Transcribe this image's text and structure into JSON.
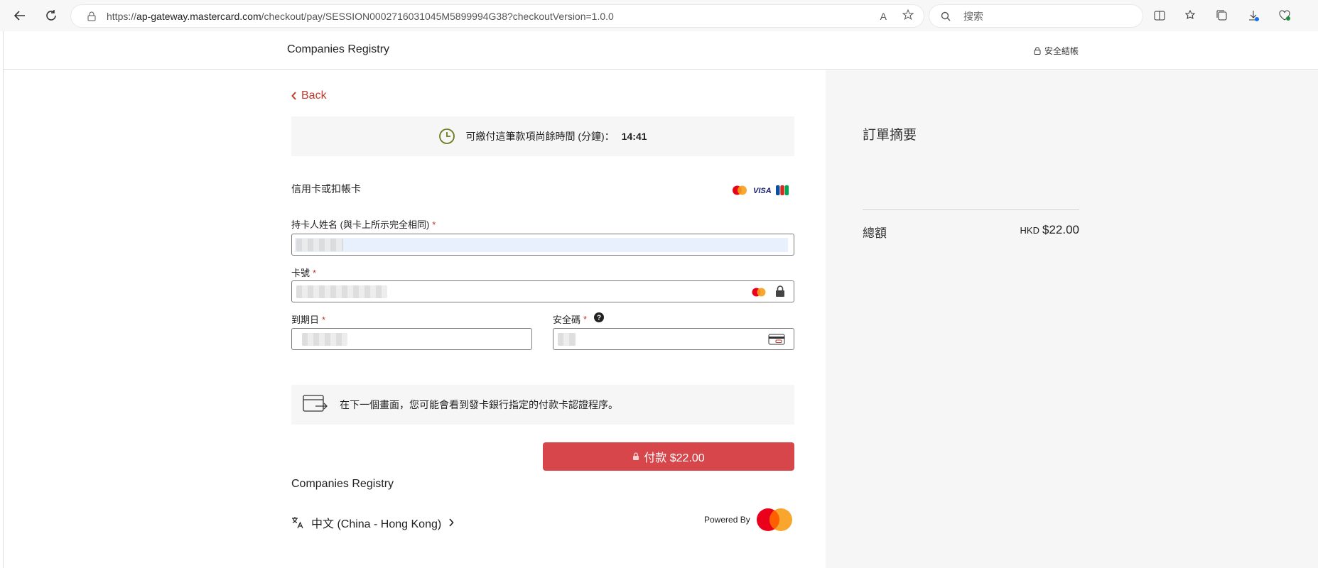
{
  "browser": {
    "url_prefix": "https://",
    "url_host": "ap-gateway.mastercard.com",
    "url_path": "/checkout/pay/SESSION0002716031045M5899994G38?checkoutVersion=1.0.0",
    "search_placeholder": "搜索"
  },
  "header": {
    "merchant": "Companies Registry",
    "secure_label": "安全結帳"
  },
  "back_label": "Back",
  "timer": {
    "label": "可繳付這筆款項尚餘時間 (分鐘)：",
    "value": "14:41"
  },
  "payment_method": "信用卡或扣帳卡",
  "form": {
    "cardholder_label": "持卡人姓名 (與卡上所示完全相同)",
    "card_number_label": "卡號",
    "expiry_label": "到期日",
    "cvv_label": "安全碼",
    "required_mark": "*"
  },
  "info_message": "在下一個畫面，您可能會看到發卡銀行指定的付款卡認證程序。",
  "pay_button": "付款 $22.00",
  "footer": {
    "merchant": "Companies Registry",
    "language": "中文 (China - Hong Kong)",
    "powered_by": "Powered By"
  },
  "summary": {
    "title": "訂單摘要",
    "total_label": "總額",
    "currency": "HKD",
    "total_value": "$22.00"
  },
  "colors": {
    "accent": "#d6464a",
    "link": "#c0392b",
    "panel": "#f6f6f6"
  }
}
